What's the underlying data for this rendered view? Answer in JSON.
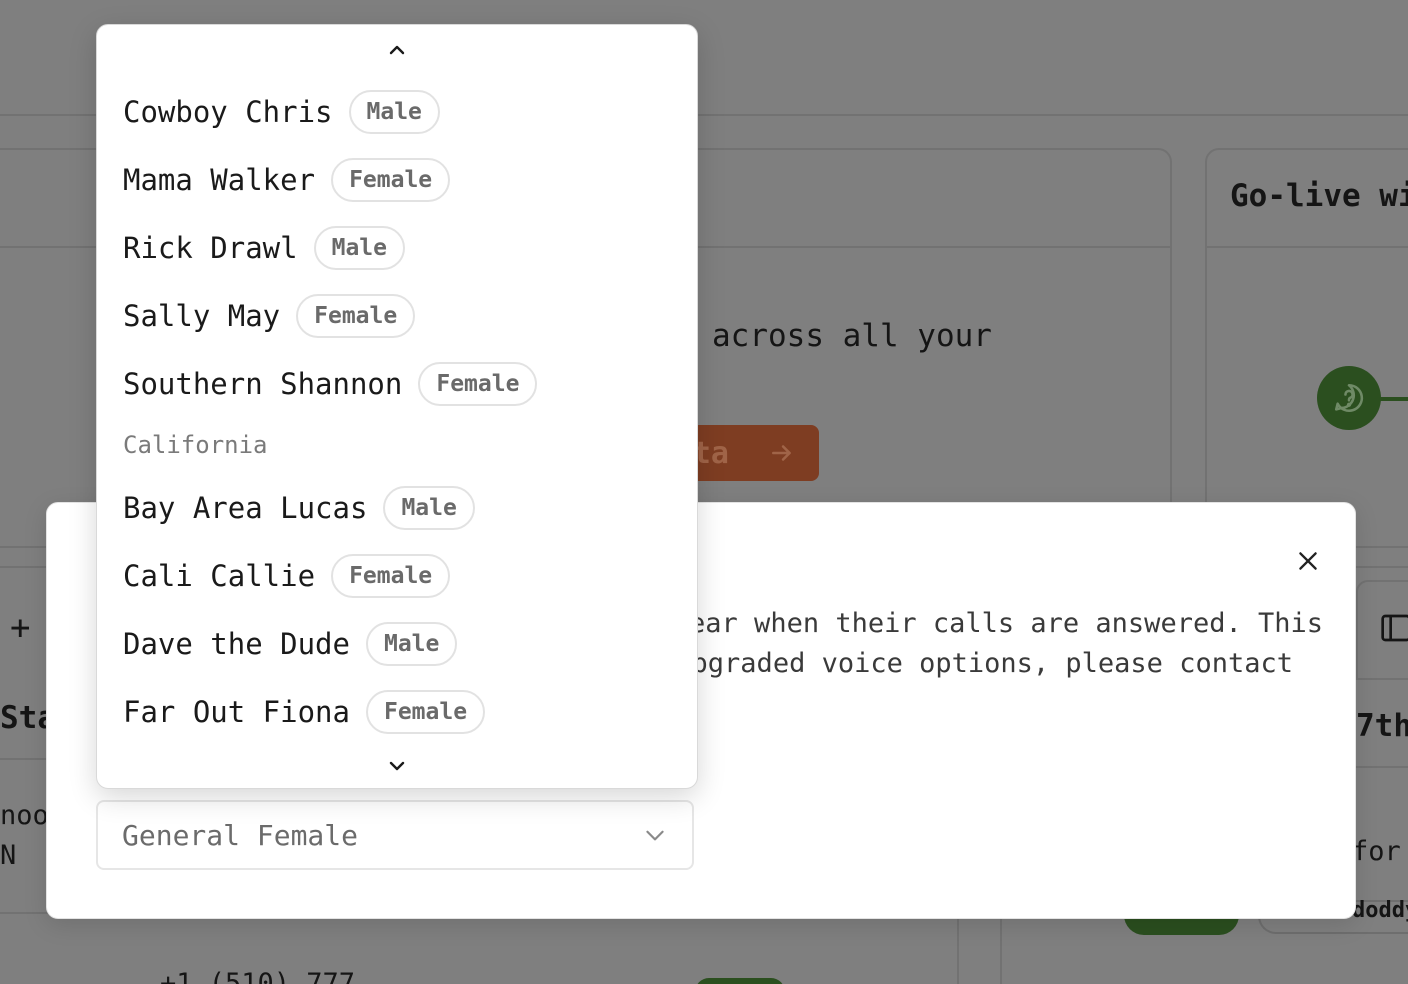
{
  "background": {
    "card_text": "across all your",
    "cta_label": "ta",
    "golive_title": "Go-live wi",
    "modal_behind_fragments": [
      "Sta",
      "noo",
      "N",
      "7th",
      "for",
      "doddy",
      "+1 (510) 777"
    ]
  },
  "modal": {
    "description_line1": "hear when their calls are answered. This",
    "description_line2": "upgraded voice options, please contact"
  },
  "select": {
    "value": "General Female"
  },
  "dropdown": {
    "options_top": [
      {
        "name": "Cowboy Chris",
        "gender": "Male"
      },
      {
        "name": "Mama Walker",
        "gender": "Female"
      },
      {
        "name": "Rick Drawl",
        "gender": "Male"
      },
      {
        "name": "Sally May",
        "gender": "Female"
      },
      {
        "name": "Southern Shannon",
        "gender": "Female"
      }
    ],
    "group_label": "California",
    "options_group": [
      {
        "name": "Bay Area Lucas",
        "gender": "Male"
      },
      {
        "name": "Cali Callie",
        "gender": "Female"
      },
      {
        "name": "Dave the Dude",
        "gender": "Male"
      },
      {
        "name": "Far Out Fiona",
        "gender": "Female"
      }
    ]
  },
  "colors": {
    "overlay": "#7f7f7f",
    "cta": "#7e3d22",
    "help_fab": "#2b4f1f"
  }
}
